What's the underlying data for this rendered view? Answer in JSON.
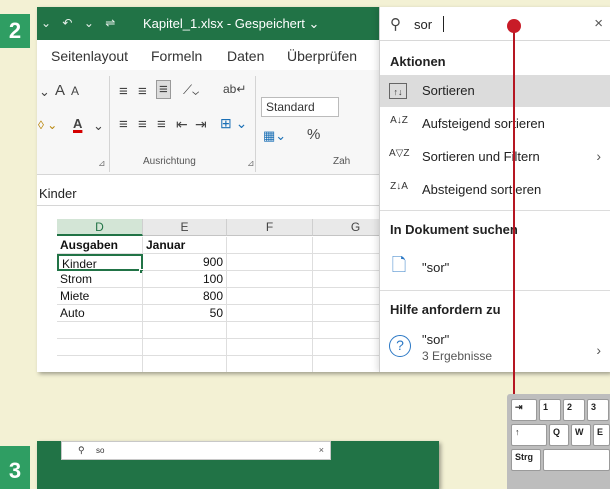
{
  "steps": {
    "current": "2",
    "next": "3"
  },
  "window": {
    "quick_access": [
      "⌄",
      "↶",
      "⌄",
      "⇌"
    ],
    "title": "Kapitel_1.xlsx  -  Gespeichert",
    "title_dropdown": "⌄",
    "close": "×"
  },
  "tabs": [
    "Seitenlayout",
    "Formeln",
    "Daten",
    "Überprüfen"
  ],
  "ribbon": {
    "font_grow": "A",
    "font_shrink": "A",
    "font_color_label": "A",
    "number_format": "Standard",
    "percent": "%",
    "group_alignment": "Ausrichtung",
    "group_number_partial": "Zah"
  },
  "formula_bar": {
    "value": "Kinder"
  },
  "grid": {
    "columns": [
      "D",
      "E",
      "F",
      "G"
    ],
    "rows": [
      [
        "Ausgaben",
        "Januar",
        "",
        ""
      ],
      [
        "Kinder",
        "900",
        "",
        ""
      ],
      [
        "Strom",
        "100",
        "",
        ""
      ],
      [
        "Miete",
        "800",
        "",
        ""
      ],
      [
        "Auto",
        "50",
        "",
        ""
      ],
      [
        "",
        "",
        "",
        ""
      ],
      [
        "",
        "",
        "",
        ""
      ],
      [
        "",
        "",
        "",
        ""
      ]
    ]
  },
  "search": {
    "query": "sor",
    "icon": "search-icon",
    "close": "×"
  },
  "panel": {
    "section_actions": "Aktionen",
    "actions": [
      {
        "label": "Sortieren",
        "icon": "↑↓",
        "highlighted": true
      },
      {
        "label": "Aufsteigend sortieren",
        "icon": "A↓Z"
      },
      {
        "label": "Sortieren und Filtern",
        "icon": "A▽Z",
        "arrow": "›"
      },
      {
        "label": "Absteigend sortieren",
        "icon": "Z↓A"
      }
    ],
    "section_document": "In Dokument suchen",
    "document_result": "\"sor\"",
    "section_help": "Hilfe anfordern zu",
    "help_result": "\"sor\"",
    "help_count": "3 Ergebnisse",
    "help_arrow": "›"
  },
  "keyboard": {
    "row1": [
      "⇥",
      "1",
      "2",
      "3"
    ],
    "row2": [
      "↑",
      "Q",
      "W",
      "E"
    ],
    "row3": [
      "Strg"
    ]
  },
  "step3": {
    "search_query": "so",
    "close": "×"
  },
  "colors": {
    "excel_green": "#217346",
    "pointer_red": "#c81b27",
    "background": "#f3f1d4",
    "highlight": "#dcdcdc"
  }
}
